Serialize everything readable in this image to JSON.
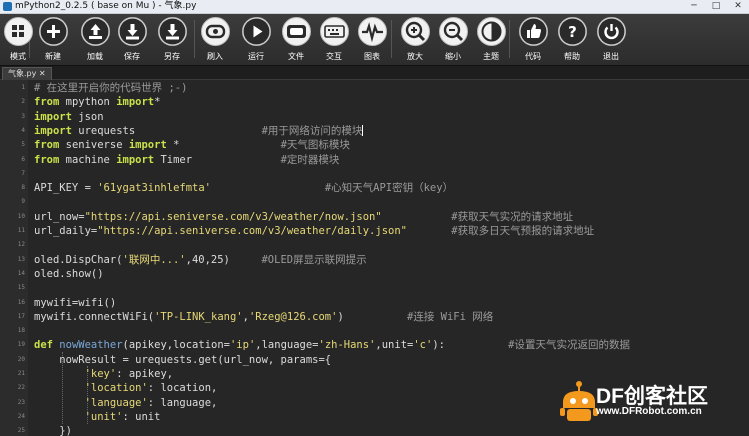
{
  "window": {
    "title": "mPython2_0.2.5 ( base on Mu ) - 气象.py",
    "controls": [
      "─",
      "□",
      "✕"
    ]
  },
  "toolbar": {
    "buttons": [
      {
        "label": "模式",
        "icon": "mode-icon"
      },
      {
        "label": "新建",
        "icon": "plus-icon"
      },
      {
        "label": "加载",
        "icon": "upload-icon"
      },
      {
        "label": "保存",
        "icon": "download-icon"
      },
      {
        "label": "另存",
        "icon": "download-icon"
      },
      {
        "label": "刷入",
        "icon": "flash-icon"
      },
      {
        "label": "运行",
        "icon": "play-icon"
      },
      {
        "label": "文件",
        "icon": "files-icon"
      },
      {
        "label": "交互",
        "icon": "keyboard-icon"
      },
      {
        "label": "图表",
        "icon": "pulse-icon"
      },
      {
        "label": "放大",
        "icon": "zoom-in-icon"
      },
      {
        "label": "缩小",
        "icon": "zoom-out-icon"
      },
      {
        "label": "主题",
        "icon": "theme-icon"
      },
      {
        "label": "代码",
        "icon": "thumbs-up-icon"
      },
      {
        "label": "帮助",
        "icon": "help-icon"
      },
      {
        "label": "退出",
        "icon": "power-icon"
      }
    ]
  },
  "tabs": [
    {
      "label": "气象.py ✕"
    }
  ],
  "editor": {
    "lines": [
      {
        "n": "1",
        "t": [
          [
            "cmt",
            "# 在这里开启你的代码世界 ;-)"
          ]
        ]
      },
      {
        "n": "2",
        "t": [
          [
            "kw",
            "from"
          ],
          [
            "",
            " mpython "
          ],
          [
            "kw",
            "import"
          ],
          [
            "",
            "*"
          ]
        ]
      },
      {
        "n": "3",
        "t": [
          [
            "kw",
            "import"
          ],
          [
            "",
            " json"
          ]
        ]
      },
      {
        "n": "4",
        "t": [
          [
            "kw",
            "import"
          ],
          [
            "",
            " urequests                    "
          ],
          [
            "cmt",
            "#用于网络访问的模块"
          ]
        ]
      },
      {
        "n": "5",
        "t": [
          [
            "kw",
            "from"
          ],
          [
            "",
            " seniverse "
          ],
          [
            "kw",
            "import"
          ],
          [
            "",
            " *                "
          ],
          [
            "cmt",
            "#天气图标模块"
          ]
        ]
      },
      {
        "n": "6",
        "t": [
          [
            "kw",
            "from"
          ],
          [
            "",
            " machine "
          ],
          [
            "kw",
            "import"
          ],
          [
            "",
            " Timer              "
          ],
          [
            "cmt",
            "#定时器模块"
          ]
        ]
      },
      {
        "n": "7",
        "t": []
      },
      {
        "n": "8",
        "t": [
          [
            "",
            "API_KEY = "
          ],
          [
            "str",
            "'61ygat3inhlefmta'"
          ],
          [
            "",
            "                  "
          ],
          [
            "cmt",
            "#心知天气API密钥（key）"
          ]
        ]
      },
      {
        "n": "9",
        "t": []
      },
      {
        "n": "10",
        "t": [
          [
            "",
            "url_now="
          ],
          [
            "str",
            "\"https://api.seniverse.com/v3/weather/now.json\""
          ],
          [
            "",
            "           "
          ],
          [
            "cmt",
            "#获取天气实况的请求地址"
          ]
        ]
      },
      {
        "n": "11",
        "t": [
          [
            "",
            "url_daily="
          ],
          [
            "str",
            "\"https://api.seniverse.com/v3/weather/daily.json\""
          ],
          [
            "",
            "       "
          ],
          [
            "cmt",
            "#获取多日天气预报的请求地址"
          ]
        ]
      },
      {
        "n": "12",
        "t": []
      },
      {
        "n": "13",
        "t": [
          [
            "",
            "oled.DispChar("
          ],
          [
            "str",
            "'联网中...'"
          ],
          [
            "",
            ",40,25)     "
          ],
          [
            "cmt",
            "#OLED屏显示联网提示"
          ]
        ]
      },
      {
        "n": "14",
        "t": [
          [
            "",
            "oled.show()"
          ]
        ]
      },
      {
        "n": "15",
        "t": []
      },
      {
        "n": "16",
        "t": [
          [
            "",
            "mywifi=wifi()"
          ]
        ]
      },
      {
        "n": "17",
        "t": [
          [
            "",
            "mywifi.connectWiFi("
          ],
          [
            "str",
            "'TP-LINK_kang'"
          ],
          [
            "",
            ","
          ],
          [
            "str",
            "'Rzeg@126.com'"
          ],
          [
            "",
            ")          "
          ],
          [
            "cmt",
            "#连接 WiFi 网络"
          ]
        ]
      },
      {
        "n": "18",
        "t": []
      },
      {
        "n": "19",
        "t": [
          [
            "kw",
            "def"
          ],
          [
            "",
            " "
          ],
          [
            "fn",
            "nowWeather"
          ],
          [
            "",
            "(apikey,location="
          ],
          [
            "str",
            "'ip'"
          ],
          [
            "",
            ",language="
          ],
          [
            "str",
            "'zh-Hans'"
          ],
          [
            "",
            ",unit="
          ],
          [
            "str",
            "'c'"
          ],
          [
            "",
            "):          "
          ],
          [
            "cmt",
            "#设置天气实况返回的数据"
          ]
        ]
      },
      {
        "n": "20",
        "t": [
          [
            "",
            "    nowResult = urequests.get(url_now, params={"
          ]
        ]
      },
      {
        "n": "21",
        "t": [
          [
            "",
            "        "
          ],
          [
            "str",
            "'key'"
          ],
          [
            "",
            ": apikey,"
          ]
        ]
      },
      {
        "n": "22",
        "t": [
          [
            "",
            "        "
          ],
          [
            "str",
            "'location'"
          ],
          [
            "",
            ": location,"
          ]
        ]
      },
      {
        "n": "23",
        "t": [
          [
            "",
            "        "
          ],
          [
            "str",
            "'language'"
          ],
          [
            "",
            ": language,"
          ]
        ]
      },
      {
        "n": "24",
        "t": [
          [
            "",
            "        "
          ],
          [
            "str",
            "'unit'"
          ],
          [
            "",
            ": unit"
          ]
        ]
      },
      {
        "n": "25",
        "t": [
          [
            "",
            "    })"
          ]
        ]
      }
    ]
  },
  "watermark": {
    "title": "DF创客社区",
    "url": "www.DFRobot.com.cn"
  }
}
